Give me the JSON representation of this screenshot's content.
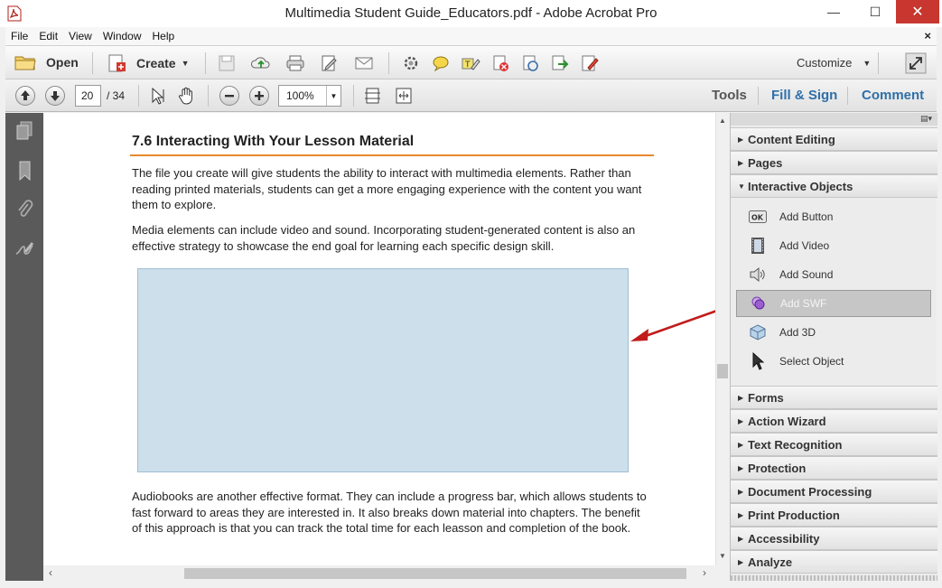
{
  "window": {
    "title": "Multimedia Student Guide_Educators.pdf - Adobe Acrobat Pro",
    "minimize": "—",
    "maximize": "☐",
    "close": "✕"
  },
  "menu": {
    "items": [
      "File",
      "Edit",
      "View",
      "Window",
      "Help"
    ],
    "close": "×"
  },
  "toolbar": {
    "open_label": "Open",
    "create_label": "Create",
    "customize_label": "Customize"
  },
  "nav": {
    "current_page": "20",
    "total_pages": "/ 34",
    "zoom": "100%",
    "tabs": [
      "Tools",
      "Fill & Sign",
      "Comment"
    ]
  },
  "document": {
    "heading": "7.6 Interacting With Your Lesson Material",
    "para1": "The file you create will give students the ability to interact with multimedia elements. Rather than reading printed materials, students can get a more engaging experience with the content you want them to explore.",
    "para2": "Media elements can include video and sound.  Incorporating student-generated content is also an effective strategy to showcase the  end goal for learning each specific design skill.",
    "para3": "Audiobooks are another effective format. They can include a progress bar, which allows students to fast forward to areas they are interested in. It also breaks down material into chapters. The benefit of this approach is that you can track the total time for each leasson and completion of the book."
  },
  "panel": {
    "sections_top": [
      "Content Editing",
      "Pages",
      "Interactive Objects"
    ],
    "tools": [
      {
        "label": "Add Button",
        "icon": "ok-button-icon"
      },
      {
        "label": "Add Video",
        "icon": "film-icon"
      },
      {
        "label": "Add Sound",
        "icon": "speaker-icon"
      },
      {
        "label": "Add SWF",
        "icon": "swf-icon",
        "selected": true
      },
      {
        "label": "Add 3D",
        "icon": "cube-icon"
      },
      {
        "label": "Select Object",
        "icon": "pointer-icon"
      }
    ],
    "sections_bottom": [
      "Forms",
      "Action Wizard",
      "Text Recognition",
      "Protection",
      "Document Processing",
      "Print Production",
      "Accessibility",
      "Analyze"
    ]
  },
  "colors": {
    "accent_rule": "#e9892e",
    "tab_blue": "#2f6fa8",
    "annotation_arrow": "#c11c1c",
    "media_placeholder": "#ccdfea"
  }
}
